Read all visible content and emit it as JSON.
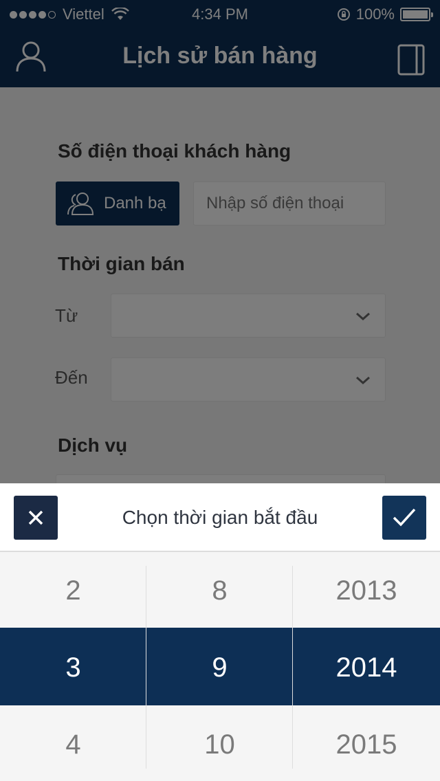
{
  "status": {
    "carrier": "Viettel",
    "time": "4:34 PM",
    "battery": "100%"
  },
  "header": {
    "title": "Lịch sử bán hàng",
    "left_icon": "user-icon",
    "right_icon": "book-icon"
  },
  "form": {
    "phone_section": "Số điện thoại khách hàng",
    "contacts_label": "Danh bạ",
    "phone_placeholder": "Nhập số điện thoại",
    "time_section": "Thời gian bán",
    "from_label": "Từ",
    "to_label": "Đến",
    "service_section": "Dịch vụ"
  },
  "picker": {
    "title": "Chọn thời gian bắt đầu",
    "day": {
      "prev": "2",
      "selected": "3",
      "next": "4"
    },
    "month": {
      "prev": "8",
      "selected": "9",
      "next": "10"
    },
    "year": {
      "prev": "2013",
      "selected": "2014",
      "next": "2015"
    }
  },
  "colors": {
    "primary": "#0d2f55",
    "sheet_bg": "#f5f5f5"
  }
}
